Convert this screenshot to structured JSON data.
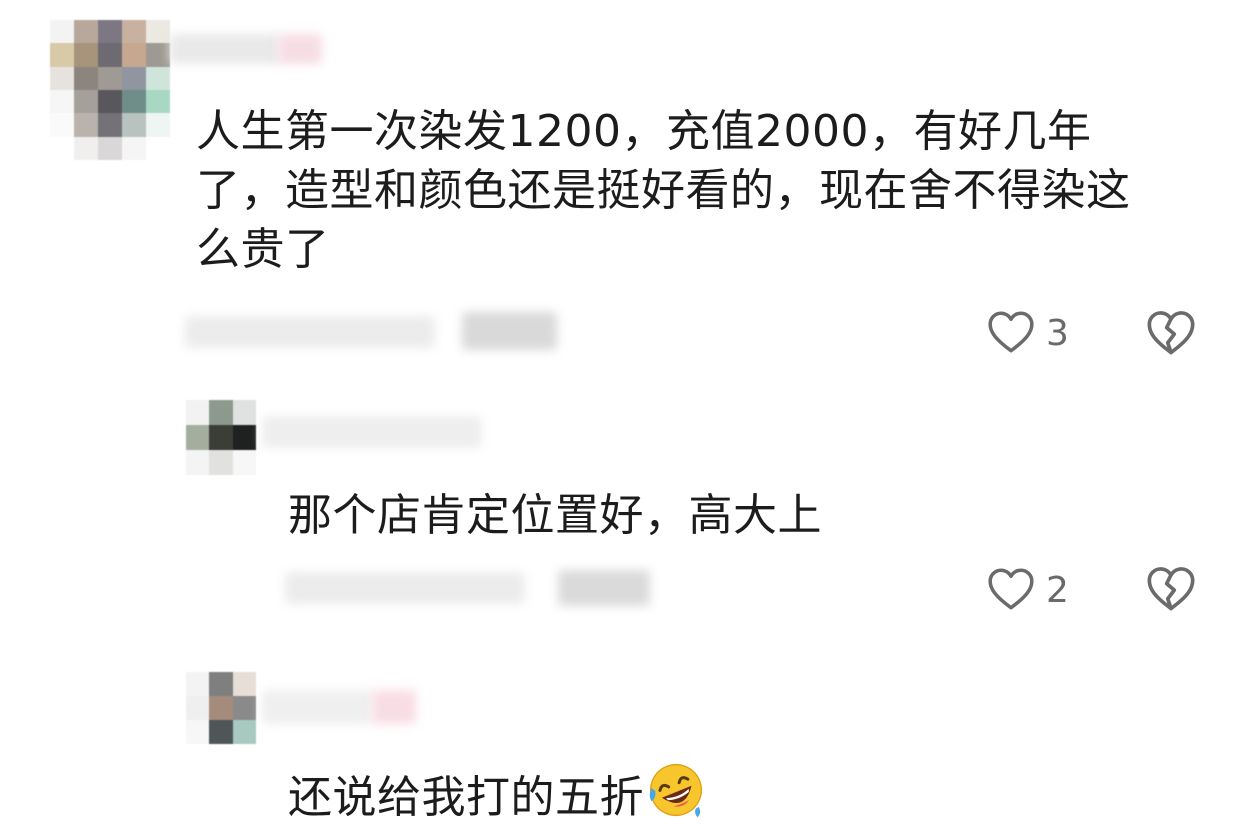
{
  "comments": [
    {
      "text": "人生第一次染发1200，充值2000，有好几年\n了，造型和颜色还是挺好看的，现在舍不得染这\n么贵了",
      "like_count": "3",
      "liked": false
    },
    {
      "text": "那个店肯定位置好，高大上",
      "like_count": "2",
      "liked": false
    },
    {
      "text": "还说给我打的五折",
      "emoji": "rolling-on-floor-laughing"
    }
  ],
  "icons": {
    "like": "heart-outline-icon",
    "dislike": "broken-heart-icon"
  },
  "colors": {
    "icon_stroke": "#6b6b6b",
    "text": "#1c1c1c",
    "count": "#6a6a6a",
    "background": "#ffffff"
  }
}
